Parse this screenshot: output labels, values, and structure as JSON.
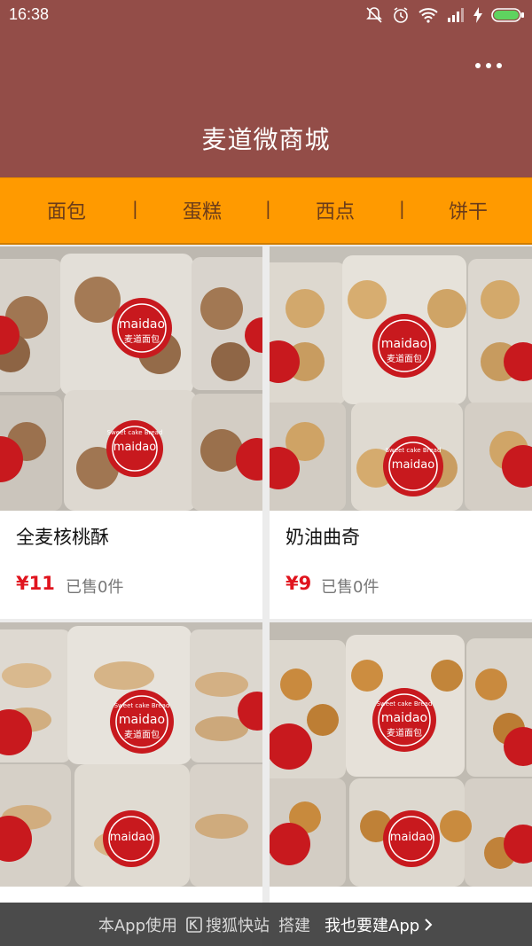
{
  "status_bar": {
    "time": "16:38"
  },
  "header": {
    "title": "麦道微商城"
  },
  "nav": {
    "tabs": [
      "面包",
      "蛋糕",
      "西点",
      "饼干"
    ],
    "separator": "|"
  },
  "products": [
    {
      "name": "全麦核桃酥",
      "price": "¥11",
      "sold": "已售0件",
      "jar_label": "maidao",
      "jar_sub": "麦道面包",
      "jar_ring": "Sweet cake Bread"
    },
    {
      "name": "奶油曲奇",
      "price": "¥9",
      "sold": "已售0件",
      "jar_label": "maidao",
      "jar_sub": "麦道面包",
      "jar_ring": "Sweet cake Bread"
    },
    {
      "name": "",
      "price": "",
      "sold": "",
      "jar_label": "maidao",
      "jar_sub": "麦道面包",
      "jar_ring": "Sweet cake Bread"
    },
    {
      "name": "",
      "price": "",
      "sold": "",
      "jar_label": "maidao",
      "jar_sub": "麦道面包",
      "jar_ring": "Sweet cake Bread"
    }
  ],
  "footer": {
    "prefix": "本App使用",
    "brand": "搜狐快站",
    "middle": "搭建",
    "cta": "我也要建App"
  },
  "colors": {
    "header": "#934d48",
    "nav": "#ff9a00",
    "price": "#e0141e",
    "label": "#c8191e"
  }
}
